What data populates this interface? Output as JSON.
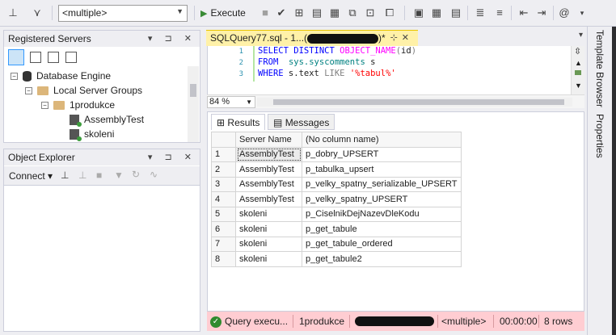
{
  "toolbar": {
    "database_select": "<multiple>",
    "execute_label": "Execute"
  },
  "registered_servers": {
    "title": "Registered Servers",
    "controls": "▾ ⊐ ✕",
    "tree": [
      {
        "label": "Database Engine",
        "expand": "−"
      },
      {
        "label": "Local Server Groups",
        "expand": "−"
      },
      {
        "label": "1produkce",
        "expand": "−"
      },
      {
        "label": "AssemblyTest"
      },
      {
        "label": "skoleni"
      }
    ]
  },
  "object_explorer": {
    "title": "Object Explorer",
    "controls": "▾ ⊐ ✕",
    "connect_label": "Connect"
  },
  "editor": {
    "tab_title": "SQLQuery77.sql - 1...(",
    "tab_title_end": ")*",
    "line_numbers": [
      "1",
      "2",
      "3"
    ],
    "zoom": "84 %"
  },
  "results": {
    "tab_results": "Results",
    "tab_messages": "Messages",
    "columns": [
      "Server Name",
      "(No column name)"
    ],
    "rows": [
      {
        "n": "1",
        "server": "AssemblyTest",
        "name": "p_dobry_UPSERT"
      },
      {
        "n": "2",
        "server": "AssemblyTest",
        "name": "p_tabulka_upsert"
      },
      {
        "n": "3",
        "server": "AssemblyTest",
        "name": "p_velky_spatny_serializable_UPSERT"
      },
      {
        "n": "4",
        "server": "AssemblyTest",
        "name": "p_velky_spatny_UPSERT"
      },
      {
        "n": "5",
        "server": "skoleni",
        "name": "p_CiselnikDejNazevDleKodu"
      },
      {
        "n": "6",
        "server": "skoleni",
        "name": "p_get_tabule"
      },
      {
        "n": "7",
        "server": "skoleni",
        "name": "p_get_tabule_ordered"
      },
      {
        "n": "8",
        "server": "skoleni",
        "name": "p_get_tabule2"
      }
    ]
  },
  "status": {
    "message": "Query execu...",
    "server": "1produkce",
    "database": "<multiple>",
    "time": "00:00:00",
    "rows": "8 rows"
  },
  "right_panel": {
    "template_browser": "Template Browser",
    "properties": "Properties"
  }
}
